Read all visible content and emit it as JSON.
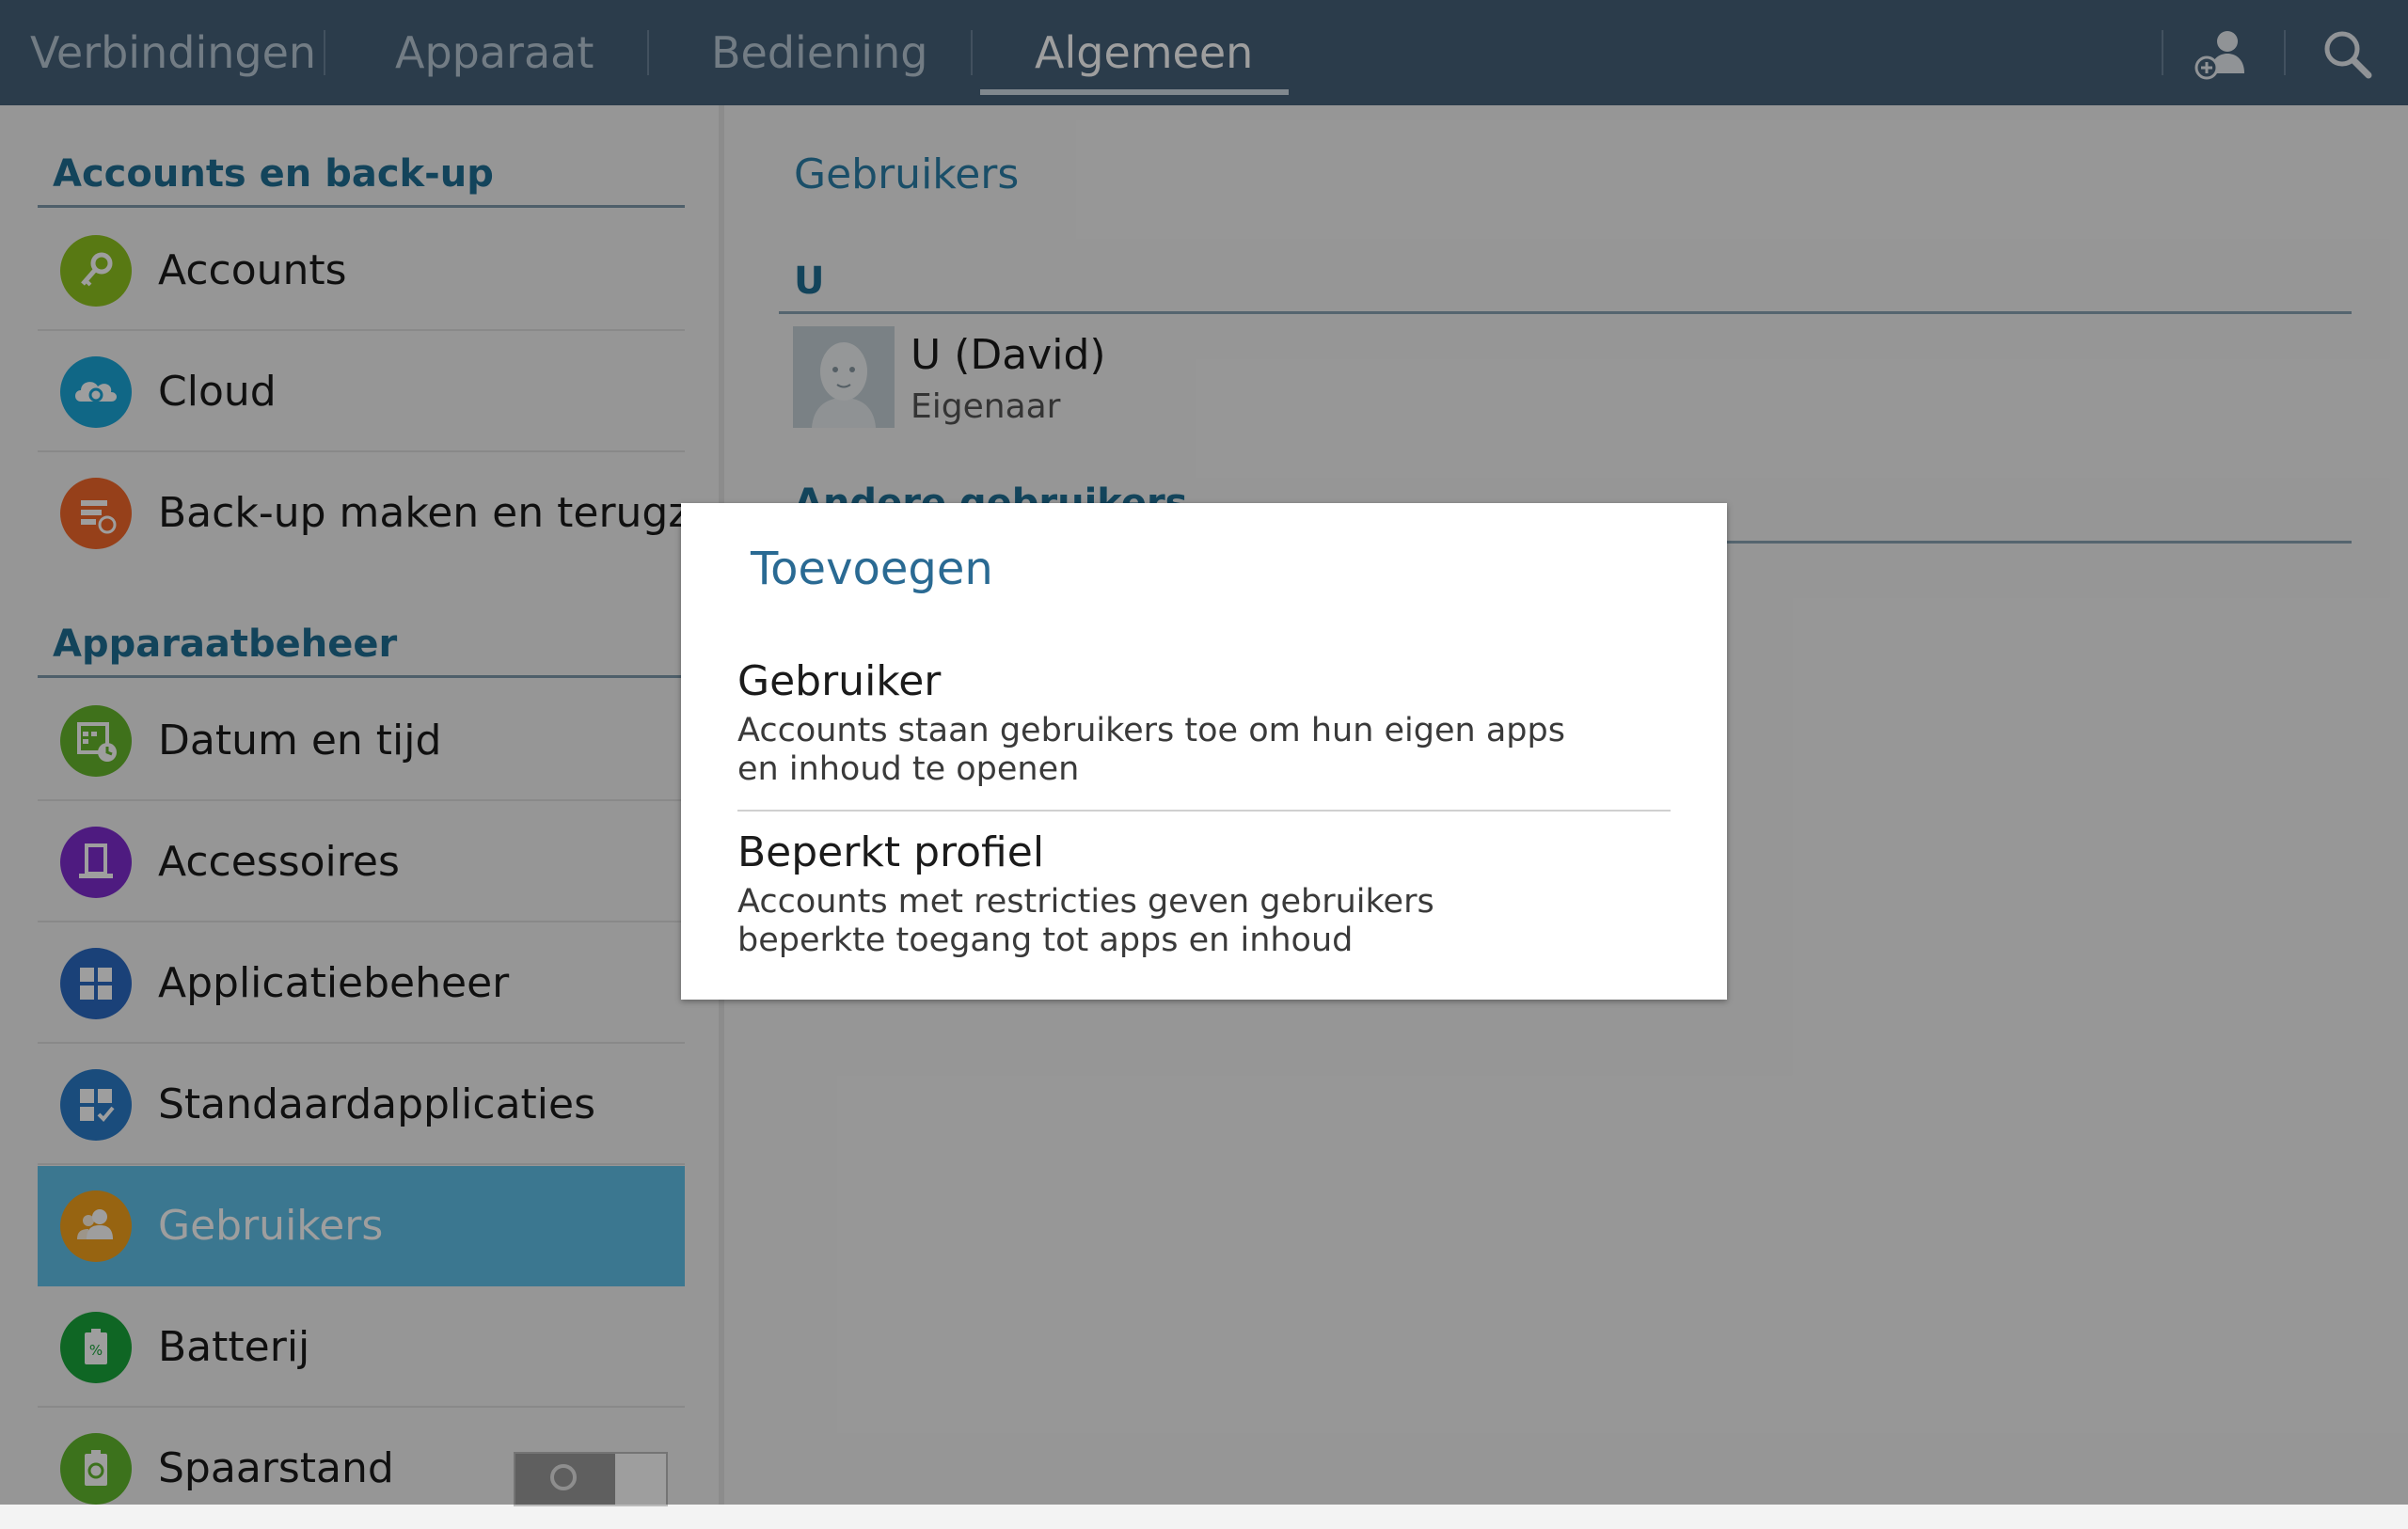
{
  "tabs": [
    {
      "label": "Verbindingen",
      "active": false
    },
    {
      "label": "Apparaat",
      "active": false
    },
    {
      "label": "Bediening",
      "active": false
    },
    {
      "label": "Algemeen",
      "active": true
    }
  ],
  "top_icons": [
    "add-user-icon",
    "search-icon"
  ],
  "left_panel": {
    "sections": [
      {
        "header": "Accounts en back-up",
        "items": [
          {
            "label": "Accounts",
            "icon": "key-icon",
            "color": "#8fc31f"
          },
          {
            "label": "Cloud",
            "icon": "cloud-sync-icon",
            "color": "#1aa6d8"
          },
          {
            "label": "Back-up maken en terugzetten",
            "icon": "backup-icon",
            "color": "#f2682a"
          }
        ]
      },
      {
        "header": "Apparaatbeheer",
        "items": [
          {
            "label": "Datum en tijd",
            "icon": "calendar-clock-icon",
            "color": "#67b72d"
          },
          {
            "label": "Accessoires",
            "icon": "accessory-icon",
            "color": "#7e2dcf"
          },
          {
            "label": "Applicatiebeheer",
            "icon": "apps-grid-icon",
            "color": "#2a69c2"
          },
          {
            "label": "Standaardapplicaties",
            "icon": "default-apps-icon",
            "color": "#2a7bc9"
          },
          {
            "label": "Gebruikers",
            "icon": "users-icon",
            "color": "#f4a21c",
            "selected": true
          },
          {
            "label": "Batterij",
            "icon": "battery-icon",
            "color": "#19a53a"
          },
          {
            "label": "Spaarstand",
            "icon": "power-saving-icon",
            "color": "#62b82e",
            "toggle": "off"
          }
        ]
      }
    ]
  },
  "right_panel": {
    "title": "Gebruikers",
    "section_u": "U",
    "user": {
      "name": "U (David)",
      "role": "Eigenaar"
    },
    "hidden_header": "Andere gebruikers"
  },
  "dialog": {
    "title": "Toevoegen",
    "options": [
      {
        "title": "Gebruiker",
        "description": "Accounts staan gebruikers toe om hun eigen apps en inhoud te openen"
      },
      {
        "title": "Beperkt profiel",
        "description": "Accounts met restricties geven gebruikers beperkte toegang tot apps en inhoud"
      }
    ]
  }
}
